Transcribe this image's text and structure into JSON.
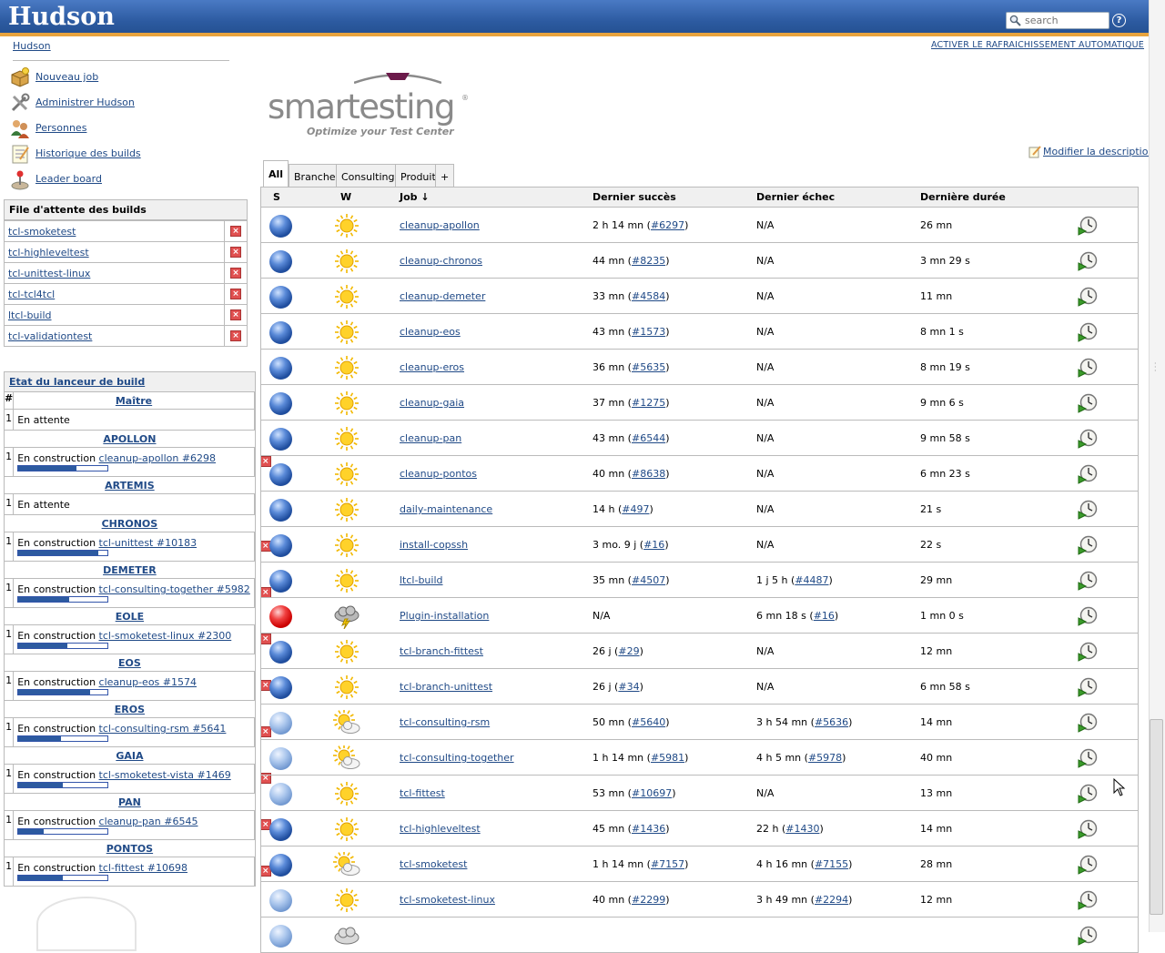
{
  "app": {
    "title": "Hudson"
  },
  "search": {
    "placeholder": "search"
  },
  "header": {
    "help_label": "?",
    "autorefresh_label": "ACTIVER LE RAFRAICHISSEMENT AUTOMATIQUE"
  },
  "breadcrumb": {
    "root": "Hudson"
  },
  "tasks": [
    {
      "label": "Nouveau job",
      "icon": "new-package-icon"
    },
    {
      "label": "Administrer Hudson",
      "icon": "tools-icon"
    },
    {
      "label": "Personnes",
      "icon": "people-icon"
    },
    {
      "label": "Historique des builds",
      "icon": "notepad-icon"
    },
    {
      "label": "Leader board",
      "icon": "joystick-icon"
    }
  ],
  "queue": {
    "title": "File d'attente des builds",
    "items": [
      "tcl-smoketest",
      "tcl-highleveltest",
      "tcl-unittest-linux",
      "tcl-tcl4tcl",
      "ltcl-build",
      "tcl-validationtest"
    ]
  },
  "executors": {
    "title": "Etat du lanceur de build",
    "num_header": "#",
    "nodes": [
      {
        "name": "Maître",
        "rows": [
          {
            "n": "1",
            "status": "En attente"
          }
        ]
      },
      {
        "name": "APOLLON",
        "rows": [
          {
            "n": "1",
            "status": "En construction",
            "job": "cleanup-apollon #6298",
            "progress": 0.65
          }
        ]
      },
      {
        "name": "ARTEMIS",
        "rows": [
          {
            "n": "1",
            "status": "En attente"
          }
        ]
      },
      {
        "name": "CHRONOS",
        "rows": [
          {
            "n": "1",
            "status": "En construction",
            "job": "tcl-unittest #10183",
            "progress": 0.9
          }
        ]
      },
      {
        "name": "DEMETER",
        "rows": [
          {
            "n": "1",
            "status": "En construction",
            "job": "tcl-consulting-together #5982",
            "progress": 0.57
          }
        ]
      },
      {
        "name": "EOLE",
        "rows": [
          {
            "n": "1",
            "status": "En construction",
            "job": "tcl-smoketest-linux #2300",
            "progress": 0.55
          }
        ]
      },
      {
        "name": "EOS",
        "rows": [
          {
            "n": "1",
            "status": "En construction",
            "job": "cleanup-eos #1574",
            "progress": 0.8
          }
        ]
      },
      {
        "name": "EROS",
        "rows": [
          {
            "n": "1",
            "status": "En construction",
            "job": "tcl-consulting-rsm #5641",
            "progress": 0.48
          }
        ]
      },
      {
        "name": "GAIA",
        "rows": [
          {
            "n": "1",
            "status": "En construction",
            "job": "tcl-smoketest-vista #1469",
            "progress": 0.5
          }
        ]
      },
      {
        "name": "PAN",
        "rows": [
          {
            "n": "1",
            "status": "En construction",
            "job": "cleanup-pan #6545",
            "progress": 0.28
          }
        ]
      },
      {
        "name": "PONTOS",
        "rows": [
          {
            "n": "1",
            "status": "En construction",
            "job": "tcl-fittest #10698",
            "progress": 0.5
          }
        ]
      }
    ]
  },
  "brand": {
    "wordmark": "smartesting",
    "registered": "®",
    "tagline": "Optimize your Test Center"
  },
  "edit_description": "Modifier la description",
  "view_tabs": [
    {
      "label": "All",
      "active": true
    },
    {
      "label": "Branche",
      "active": false
    },
    {
      "label": "Consulting",
      "active": false
    },
    {
      "label": "Produit",
      "active": false
    },
    {
      "label": "+",
      "active": false
    }
  ],
  "columns": {
    "s": "S",
    "w": "W",
    "job": "Job ↓",
    "last_success": "Dernier succès",
    "last_failure": "Dernier échec",
    "last_duration": "Dernière durée"
  },
  "jobs": [
    {
      "name": "cleanup-apollon",
      "status": "blue",
      "weather": "sunny",
      "success_time": "2 h 14 mn",
      "success_build": "#6297",
      "failure_time": "N/A",
      "failure_build": "",
      "duration": "26 mn"
    },
    {
      "name": "cleanup-chronos",
      "status": "blue",
      "weather": "sunny",
      "success_time": "44 mn",
      "success_build": "#8235",
      "failure_time": "N/A",
      "failure_build": "",
      "duration": "3 mn 29 s"
    },
    {
      "name": "cleanup-demeter",
      "status": "blue",
      "weather": "sunny",
      "success_time": "33 mn",
      "success_build": "#4584",
      "failure_time": "N/A",
      "failure_build": "",
      "duration": "11 mn"
    },
    {
      "name": "cleanup-eos",
      "status": "blue",
      "weather": "sunny",
      "success_time": "43 mn",
      "success_build": "#1573",
      "failure_time": "N/A",
      "failure_build": "",
      "duration": "8 mn 1 s"
    },
    {
      "name": "cleanup-eros",
      "status": "blue",
      "weather": "sunny",
      "success_time": "36 mn",
      "success_build": "#5635",
      "failure_time": "N/A",
      "failure_build": "",
      "duration": "8 mn 19 s"
    },
    {
      "name": "cleanup-gaia",
      "status": "blue",
      "weather": "sunny",
      "success_time": "37 mn",
      "success_build": "#1275",
      "failure_time": "N/A",
      "failure_build": "",
      "duration": "9 mn 6 s"
    },
    {
      "name": "cleanup-pan",
      "status": "blue",
      "weather": "sunny",
      "success_time": "43 mn",
      "success_build": "#6544",
      "failure_time": "N/A",
      "failure_build": "",
      "duration": "9 mn 58 s"
    },
    {
      "name": "cleanup-pontos",
      "status": "blue",
      "weather": "sunny",
      "success_time": "40 mn",
      "success_build": "#8638",
      "failure_time": "N/A",
      "failure_build": "",
      "duration": "6 mn 23 s"
    },
    {
      "name": "daily-maintenance",
      "status": "blue",
      "weather": "sunny",
      "success_time": "14 h",
      "success_build": "#497",
      "failure_time": "N/A",
      "failure_build": "",
      "duration": "21 s"
    },
    {
      "name": "install-copssh",
      "status": "blue",
      "weather": "sunny",
      "success_time": "3 mo. 9 j",
      "success_build": "#16",
      "failure_time": "N/A",
      "failure_build": "",
      "duration": "22 s"
    },
    {
      "name": "ltcl-build",
      "status": "blue",
      "weather": "sunny",
      "success_time": "35 mn",
      "success_build": "#4507",
      "failure_time": "1 j 5 h",
      "failure_build": "#4487",
      "duration": "29 mn"
    },
    {
      "name": "Plugin-installation",
      "status": "red",
      "weather": "storm",
      "success_time": "N/A",
      "success_build": "",
      "failure_time": "6 mn 18 s",
      "failure_build": "#16",
      "duration": "1 mn 0 s"
    },
    {
      "name": "tcl-branch-fittest",
      "status": "blue",
      "weather": "sunny",
      "success_time": "26 j",
      "success_build": "#29",
      "failure_time": "N/A",
      "failure_build": "",
      "duration": "12 mn"
    },
    {
      "name": "tcl-branch-unittest",
      "status": "blue",
      "weather": "sunny",
      "success_time": "26 j",
      "success_build": "#34",
      "failure_time": "N/A",
      "failure_build": "",
      "duration": "6 mn 58 s"
    },
    {
      "name": "tcl-consulting-rsm",
      "status": "lite",
      "weather": "partly",
      "success_time": "50 mn",
      "success_build": "#5640",
      "failure_time": "3 h 54 mn",
      "failure_build": "#5636",
      "duration": "14 mn"
    },
    {
      "name": "tcl-consulting-together",
      "status": "lite",
      "weather": "partly",
      "success_time": "1 h 14 mn",
      "success_build": "#5981",
      "failure_time": "4 h 5 mn",
      "failure_build": "#5978",
      "duration": "40 mn"
    },
    {
      "name": "tcl-fittest",
      "status": "lite",
      "weather": "sunny",
      "success_time": "53 mn",
      "success_build": "#10697",
      "failure_time": "N/A",
      "failure_build": "",
      "duration": "13 mn"
    },
    {
      "name": "tcl-highleveltest",
      "status": "blue",
      "weather": "sunny",
      "success_time": "45 mn",
      "success_build": "#1436",
      "failure_time": "22 h",
      "failure_build": "#1430",
      "duration": "14 mn"
    },
    {
      "name": "tcl-smoketest",
      "status": "blue",
      "weather": "partly",
      "success_time": "1 h 14 mn",
      "success_build": "#7157",
      "failure_time": "4 h 16 mn",
      "failure_build": "#7155",
      "duration": "28 mn"
    },
    {
      "name": "tcl-smoketest-linux",
      "status": "lite",
      "weather": "sunny",
      "success_time": "40 mn",
      "success_build": "#2299",
      "failure_time": "3 h 49 mn",
      "failure_build": "#2294",
      "duration": "12 mn"
    },
    {
      "name": "",
      "status": "lite",
      "weather": "cloudy",
      "success_time": "",
      "success_build": "",
      "failure_time": "",
      "failure_build": "",
      "duration": ""
    }
  ],
  "colors": {
    "header_blue": "#2c5aa0",
    "header_accent": "#e8a33d",
    "link": "#204a87",
    "status_blue": "#2d5597",
    "status_red": "#cc0000"
  }
}
